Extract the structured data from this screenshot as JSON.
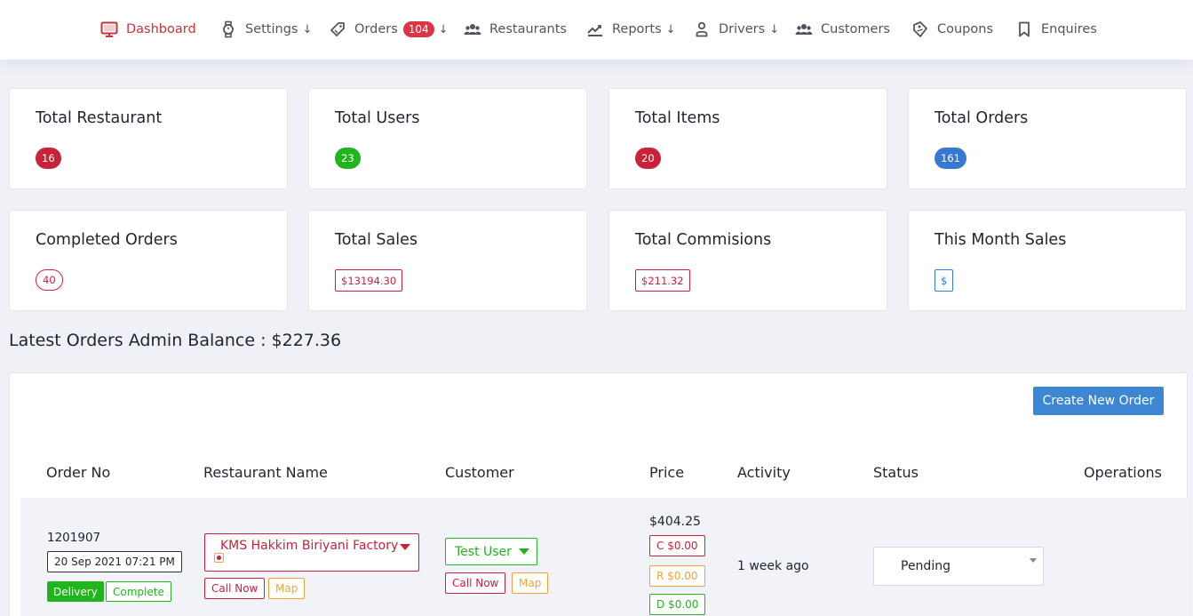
{
  "nav": {
    "items": [
      {
        "label": "Dashboard",
        "icon": "monitor-icon"
      },
      {
        "label": "Settings",
        "icon": "watch-icon",
        "arrow": "↓"
      },
      {
        "label": "Orders",
        "icon": "tag-icon",
        "badge": "104",
        "arrow": "↓"
      },
      {
        "label": "Restaurants",
        "icon": "users-icon"
      },
      {
        "label": "Reports",
        "icon": "chart-icon",
        "arrow": "↓"
      },
      {
        "label": "Drivers",
        "icon": "person-icon",
        "arrow": "↓"
      },
      {
        "label": "Customers",
        "icon": "users-icon"
      },
      {
        "label": "Coupons",
        "icon": "coupon-icon"
      },
      {
        "label": "Enquires",
        "icon": "bookmark-icon"
      }
    ]
  },
  "stats": [
    {
      "title": "Total Restaurant",
      "value": "16"
    },
    {
      "title": "Total Users",
      "value": "23"
    },
    {
      "title": "Total Items",
      "value": "20"
    },
    {
      "title": "Total Orders",
      "value": "161"
    },
    {
      "title": "Completed Orders",
      "value": "40"
    },
    {
      "title": "Total Sales",
      "value": "$13194.30"
    },
    {
      "title": "Total Commisions",
      "value": "$211.32"
    },
    {
      "title": "This Month Sales",
      "value": "$"
    }
  ],
  "section_title": "Latest Orders Admin Balance : $227.36",
  "create_button": "Create New Order",
  "table": {
    "headers": [
      "Order No",
      "Restaurant Name",
      "Customer",
      "Price",
      "Activity",
      "Status",
      "Operations"
    ],
    "rows": [
      {
        "order_no": "1201907",
        "date": "20 Sep 2021 07:21 PM",
        "type": "Delivery",
        "state": "Complete",
        "restaurant": "KMS Hakkim Biriyani Factory",
        "call_now": "Call Now",
        "map": "Map",
        "customer": "Test User",
        "price": "$404.25",
        "c_amount": "C $0.00",
        "r_amount": "R $0.00",
        "d_amount": "D $0.00",
        "activity": "1 week ago",
        "status": "Pending"
      }
    ]
  },
  "colors": {
    "accent": "#c8323a",
    "green": "#20b51c",
    "blue": "#3678d2",
    "orange": "#f0a33c"
  }
}
